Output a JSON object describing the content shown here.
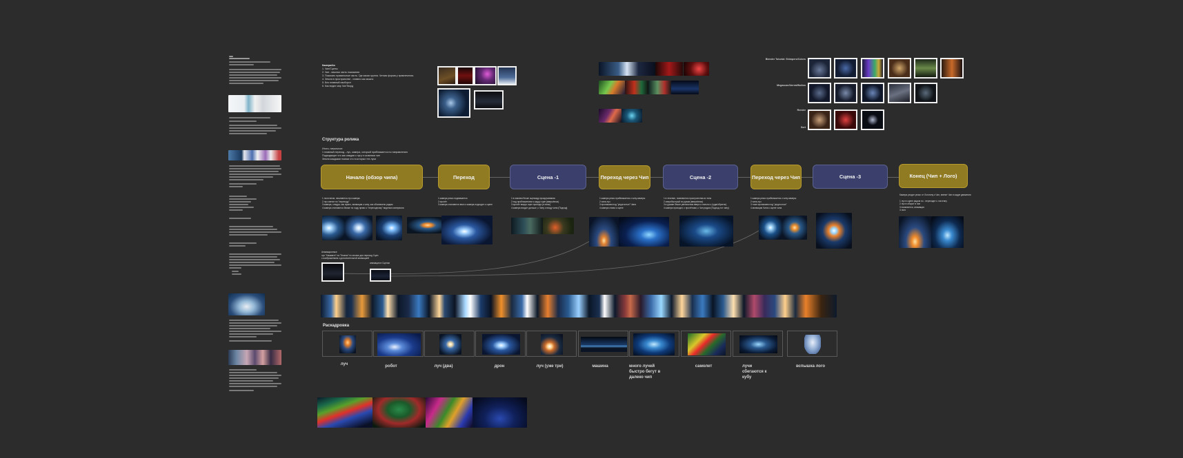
{
  "board": {
    "tasks_note": {
      "title": "Камера/Ао",
      "lines": [
        "1. Чип/Сцены",
        "2. Чип - важная часть показания",
        "3. Показать правильные часть. Где какая группа. Четкая форма у привлечения.",
        "4. Земля в пространстве - плавно как можно",
        "5. Без плавный наоборот",
        "6. Как видит мир ЧипТворд"
      ]
    },
    "structure_heading": "Структура ролика",
    "structure_note": [
      "Итоги, начальное:",
      "1 плавный переход - луч, камера, который приближается по направлению",
      "Подходящие что как каждая к лугу и сальники чип",
      "Земля каждыми поиска что в которых тех лучи"
    ],
    "stages": [
      {
        "label": "Начало (обзор чипа)",
        "color": "gold"
      },
      {
        "label": "Переход",
        "color": "gold"
      },
      {
        "label": "Сцена -1",
        "color": "navy"
      },
      {
        "label": "Переход через Чип",
        "color": "gold"
      },
      {
        "label": "Сцена -2",
        "color": "navy"
      },
      {
        "label": "Переход через Чип",
        "color": "gold"
      },
      {
        "label": "Сцена -3",
        "color": "navy"
      },
      {
        "label": "Конец (Чип + Лого)",
        "color": "gold"
      }
    ],
    "stage_notes": [
      [
        "1 логотипом, начинается луч камеры",
        "2 луч светит по \"переходу\"",
        "3 камера, следуя, как нужно, анимация к чипу, как обозначено рядом",
        "4 камера становится ближе по ходу прямо к \"переходному\" виденью материала"
      ],
      [
        "1 камера резко поднимается",
        "2 пролёт",
        "3 камера становится вниз к камера-подходит к сцене"
      ],
      [
        "1 в нижнем блоке сценкадр прокручивания",
        "2 под приближением к кадру сцен (вверх/вниз)",
        "3 пролёт вокруг сцен прохода (и плюс)",
        "4 камера входит дальше, к Чипу к входу чипа (Подход)"
      ],
      [
        "1 камера резко приближается к чипу камеры",
        "2 чипа луч",
        "3 проникаем под \"упругостью\" Чипа",
        "4 камера снова к сцене"
      ],
      [
        "1 в течение, появляются пространства из тела",
        "2 сверхбыстрый по рукам  (вверх/вниз)",
        "3 в рукаве бежит увеличения вверх и сильно к (туда/обратно)",
        "4 камера проходит, с пролётами, к Чип рядом (Подход-тот чипу)"
      ],
      [
        "1 камера резко приближается к чипу камеры",
        "2 чипа луч",
        "3 тоже проникаем под \"упругостью\"",
        "4 анимация Чипа к сцене чипа"
      ],
      [],
      [
        "Камера уходит резко от Логотипу к Чип, звенит Чип в кадре движения",
        "1 луч в сцене рядом по - переходит к логотипу",
        "2 луч в оборот в чип",
        "3 появляется, анимация",
        "4 лого"
      ]
    ],
    "sub_note": {
      "lines": [
        "Анимационные",
        "луч \"Нажмите\" на \"Кнопки\" по кнопке для переход Сцен",
        "с изображением к дополнительной анимацией"
      ]
    },
    "sub_label": "анимация в Сценах",
    "ref_labels": [
      "Blender Tutorial: Shimpers/Colors",
      "Megascan/Unreal/Notion",
      "Render",
      "Sort"
    ],
    "storyboard_heading": "Раскадровка",
    "storyboard_labels": [
      "луч",
      "робот",
      "луч  (два)",
      "дрон",
      "луч (уже три)",
      "машина",
      "много лучей быстро бегут в далеко чип",
      "самолет",
      "лучи сбегаются к кубу",
      "вспышка лого"
    ]
  }
}
